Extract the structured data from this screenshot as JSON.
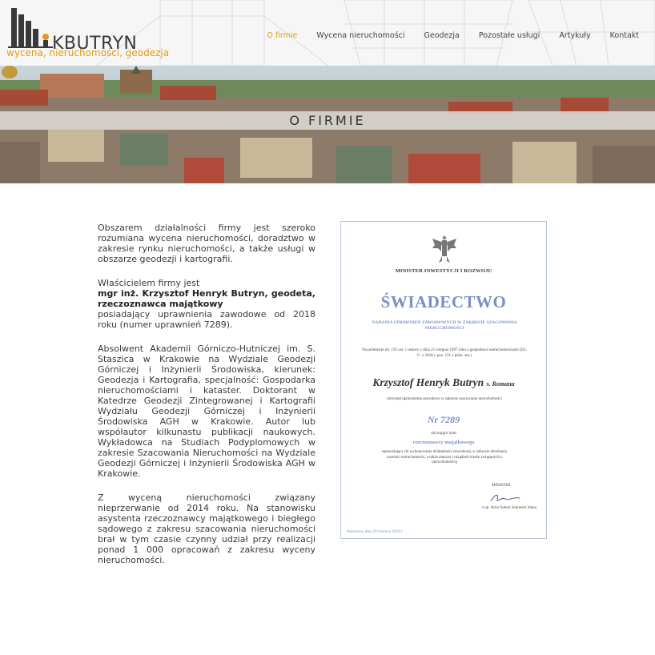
{
  "brand": {
    "name": "KBUTRYN",
    "tagline": "wycena, nieruchomości, geodezja"
  },
  "nav": {
    "items": [
      {
        "label": "O firmie",
        "active": true
      },
      {
        "label": "Wycena nieruchomości",
        "active": false
      },
      {
        "label": "Geodezja",
        "active": false
      },
      {
        "label": "Pozostałe usługi",
        "active": false
      },
      {
        "label": "Artykuły",
        "active": false
      },
      {
        "label": "Kontakt",
        "active": false
      }
    ]
  },
  "banner": {
    "title": "O FIRMIE"
  },
  "content": {
    "p1": "Obszarem działalności firmy jest szeroko rozumiana wycena nieruchomości, doradztwo w zakresie rynku nieruchomości, a także usługi w obszarze geodezji i kartografii.",
    "p2_intro": "Właścicielem firmy jest",
    "p2_bold": "mgr inż. Krzysztof Henryk Butryn, geodeta, rzeczoznawca majątkowy",
    "p2_rest": "posiadający uprawnienia zawodowe od 2018 roku (numer uprawnień 7289).",
    "p3": "Absolwent Akademii Górniczo-Hutniczej im. S. Staszica w Krakowie na Wydziale Geodezji Górniczej i Inżynierii Środowiska, kierunek: Geodezja i Kartografia, specjalność: Gospodarka nieruchomościami i kataster. Doktorant w Katedrze Geodezji Zintegrowanej i Kartografii Wydziału Geodezji Górniczej i Inżynierii Środowiska AGH w Krakowie. Autor lub współautor kilkunastu publikacji naukowych. Wykładowca na Studiach Podyplomowych w zakresie Szacowania Nieruchomości na Wydziale Geodezji Górniczej i Inżynierii Środowiska AGH w Krakowie.",
    "p4": "Z wyceną nieruchomości związany nieprzerwanie od 2014 roku. Na stanowisku asystenta rzeczoznawcy majątkowego i biegłego sądowego z zakresu szacowania nieruchomości brał w tym czasie czynny udział przy realizacji ponad 1 000 opracowań z zakresu wyceny nieruchomości."
  },
  "certificate": {
    "ministry": "MINISTER INWESTYCJI I ROZWOJU",
    "title": "ŚWIADECTWO",
    "subtitle": "NADANIA UPRAWNIEŃ ZAWODOWYCH W ZAKRESIE SZACOWANIA NIERUCHOMOŚCI",
    "legal": "Na podstawie art. 192 ust. 1 ustawy z dnia 21 sierpnia 1997 roku o gospodarce nieruchomościami (Dz. U. z 2018 r. poz. 121 z późn. zm.)",
    "holder_name": "Krzysztof Henryk Butryn",
    "holder_parent": "s. Romana",
    "received": "otrzymał uprawnienia zawodowe w zakresie szacowania nieruchomości",
    "number": "Nr 7289",
    "using_title": "używające tytuł",
    "profession": "rzeczoznawcy majątkowego",
    "entitled": "uprawniający do wykonywania działalności zawodowej w zakresie określania wartości nieruchomości, a także maszyn i urządzeń trwale związanych z nieruchomością",
    "minister_label": "MINISTER",
    "signer": "z up. Artur Soboń Sekretarz Stanu",
    "date": "Warszawa, dnia 29 czerwca 2018 r."
  },
  "colors": {
    "accent": "#e59a14",
    "certificate_blue": "#7a8fc7"
  }
}
